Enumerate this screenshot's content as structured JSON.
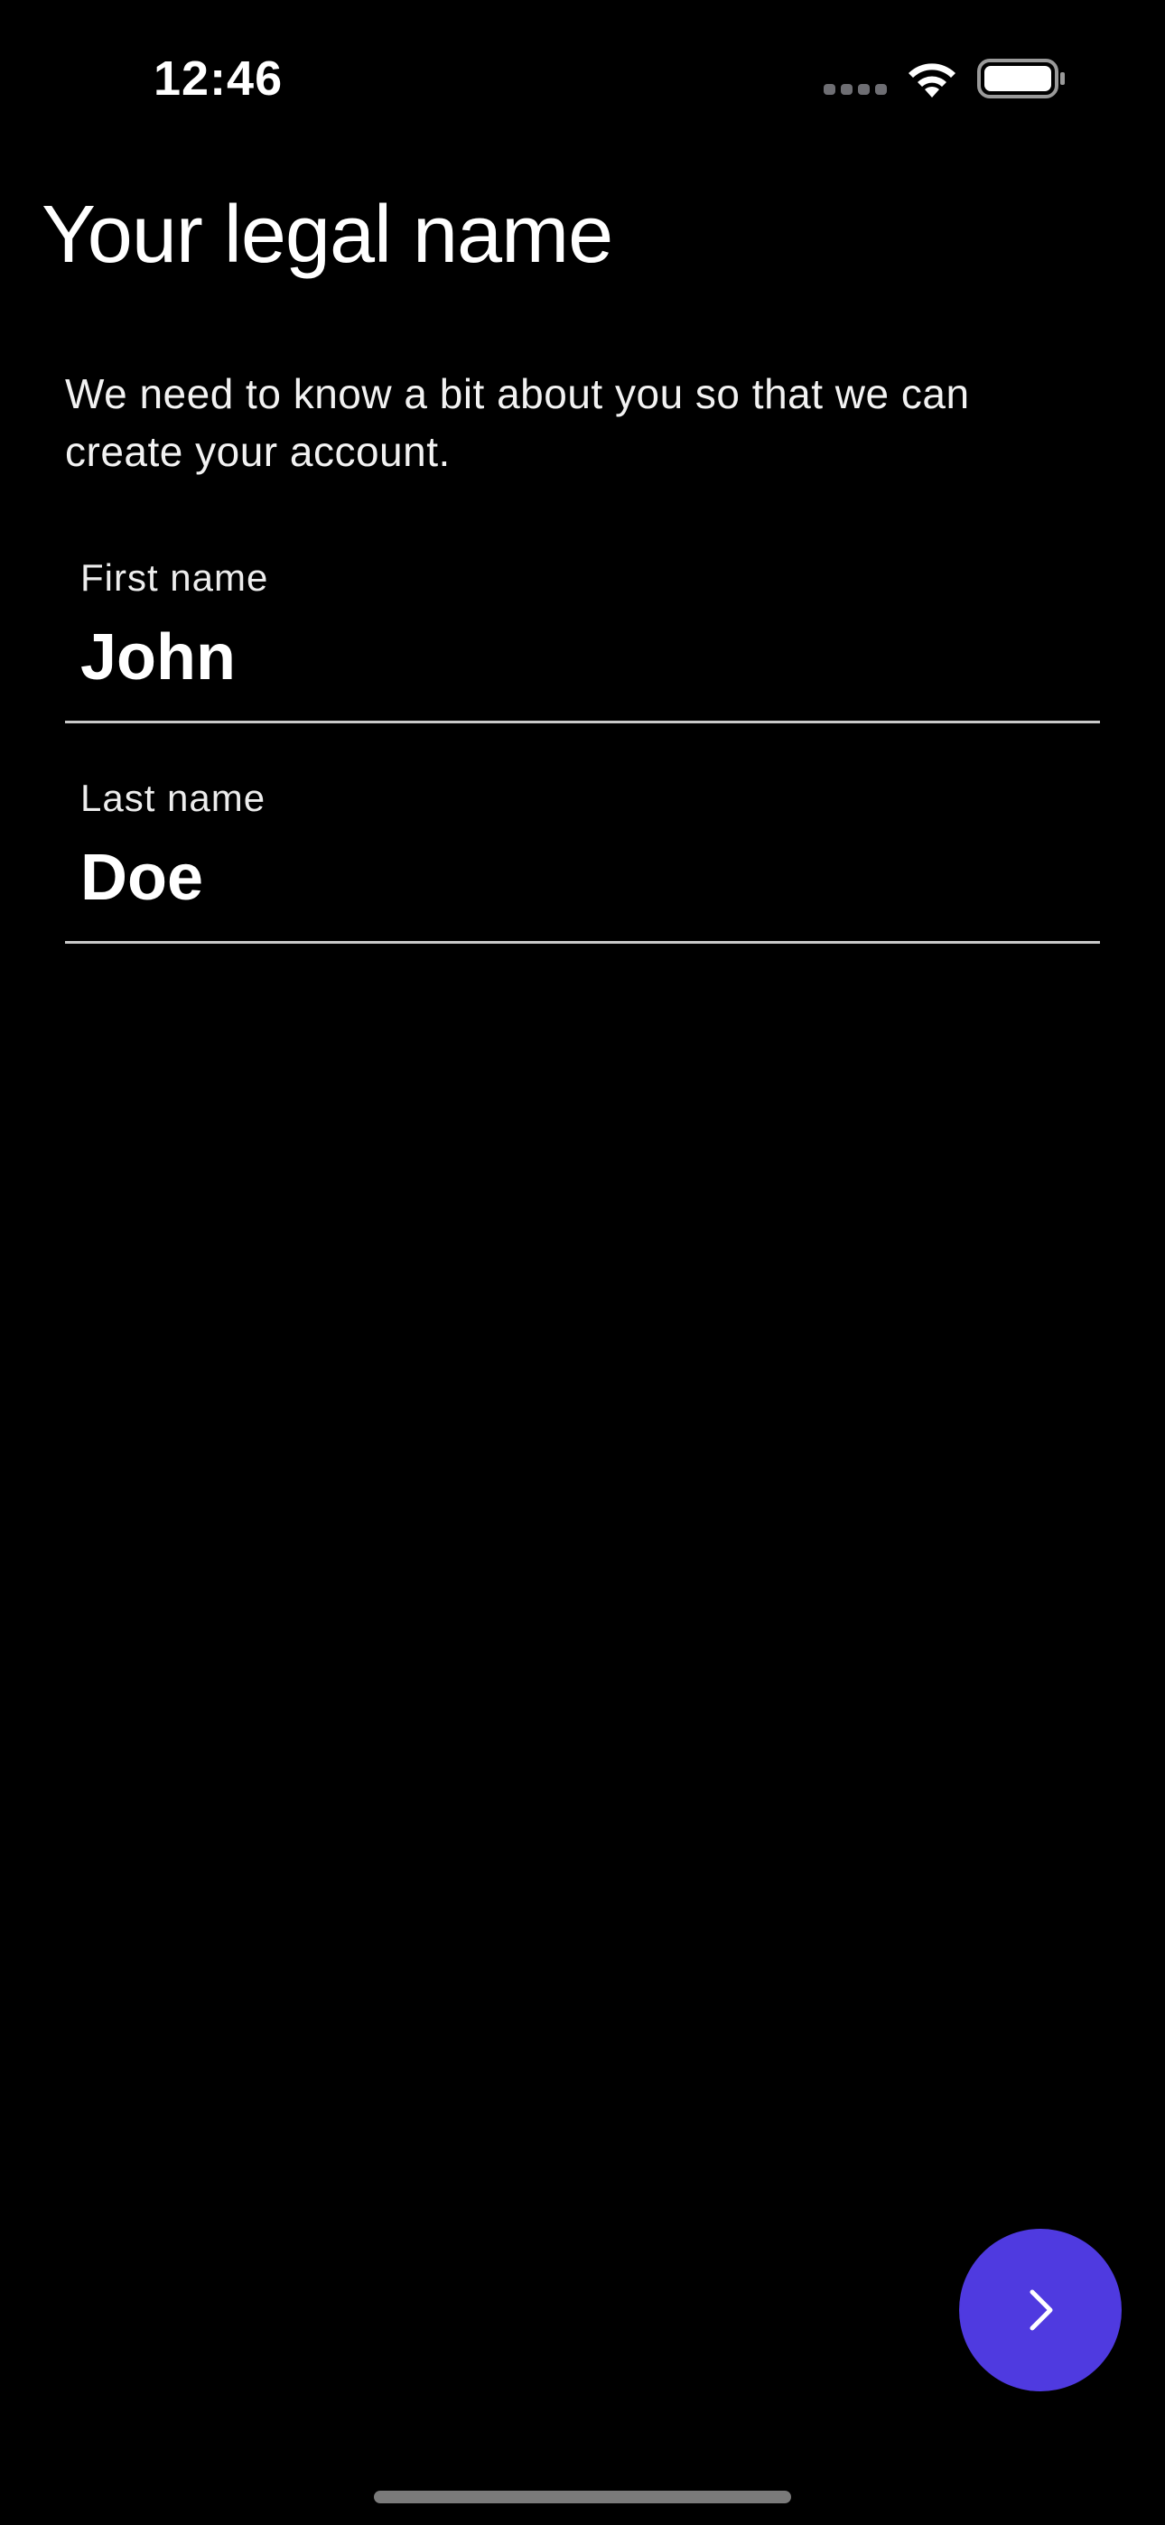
{
  "status_bar": {
    "time": "12:46",
    "icons": [
      "signal-icon",
      "wifi-icon",
      "battery-icon"
    ]
  },
  "page": {
    "title": "Your legal name",
    "description": "We need to know a bit about you so that we can create your account."
  },
  "form": {
    "first_name": {
      "label": "First name",
      "value": "John"
    },
    "last_name": {
      "label": "Last name",
      "value": "Doe"
    }
  },
  "actions": {
    "next_icon": "chevron-right-icon"
  },
  "colors": {
    "background": "#000000",
    "accent": "#4f3ae0",
    "text": "#ffffff",
    "divider": "#c9c9c9"
  }
}
